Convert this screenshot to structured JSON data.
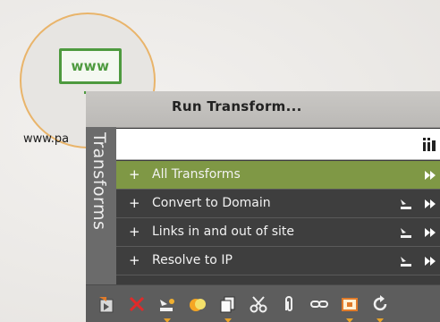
{
  "entity": {
    "icon_text": "www",
    "label": "www.pa"
  },
  "panel": {
    "title": "Run Transform...",
    "side_tab": "Transforms",
    "search": {
      "value": "",
      "placeholder": ""
    },
    "items": [
      {
        "label": "All Transforms",
        "selected": true
      },
      {
        "label": "Convert to Domain",
        "selected": false
      },
      {
        "label": "Links in and out of site",
        "selected": false
      },
      {
        "label": "Resolve to IP",
        "selected": false
      }
    ],
    "item_prefix": "+"
  },
  "toolbar": {
    "buttons": [
      "export-icon",
      "delete-icon",
      "link-icon",
      "color-icon",
      "copy-icon",
      "cut-icon",
      "attach-icon",
      "chain-link-icon",
      "frame-icon",
      "refresh-icon"
    ]
  },
  "colors": {
    "selected_row": "#7f9845",
    "panel_bg": "#3c3c3c",
    "entity_ring": "#e9b46a",
    "www_green": "#4e9a3f"
  }
}
